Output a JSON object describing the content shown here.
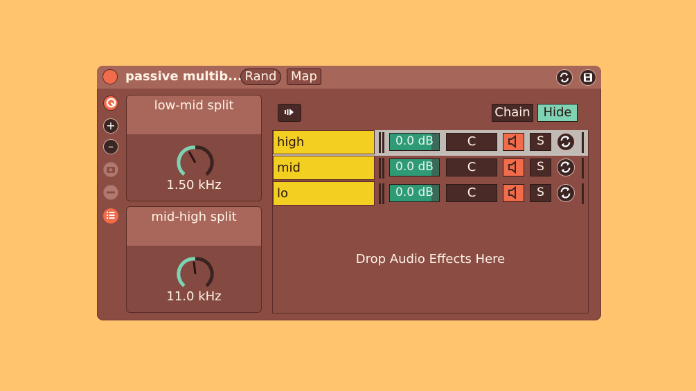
{
  "device": {
    "title": "passive multib...",
    "rand_label": "Rand",
    "map_label": "Map"
  },
  "macros": [
    {
      "label": "low-mid split",
      "value": "1.50 kHz"
    },
    {
      "label": "mid-high split",
      "value": "11.0 kHz"
    }
  ],
  "chain_header": {
    "chain_label": "Chain",
    "hide_label": "Hide"
  },
  "chains": [
    {
      "name": "high",
      "volume": "0.0 dB",
      "volume_level": 0.85,
      "pan": "C",
      "solo": "S",
      "selected": true
    },
    {
      "name": "mid",
      "volume": "0.0 dB",
      "volume_level": 0.85,
      "pan": "C",
      "solo": "S",
      "selected": false
    },
    {
      "name": "lo",
      "volume": "0.0 dB",
      "volume_level": 0.85,
      "pan": "C",
      "solo": "S",
      "selected": false
    }
  ],
  "drop_text": "Drop Audio Effects Here",
  "colors": {
    "background": "#ffc46d",
    "device_body": "#8a4c43",
    "title_bar": "#a7665a",
    "accent_orange": "#f26b4a",
    "chain_yellow": "#f3cf22",
    "volume_green": "#2e9a76",
    "hide_teal": "#7fd3b5"
  },
  "icons": [
    "power-icon",
    "randomize-icon",
    "save-icon",
    "hot-swap-icon",
    "add-icon",
    "remove-icon",
    "snapshot-icon",
    "minus-icon",
    "list-icon",
    "play-chain-icon",
    "speaker-icon"
  ]
}
